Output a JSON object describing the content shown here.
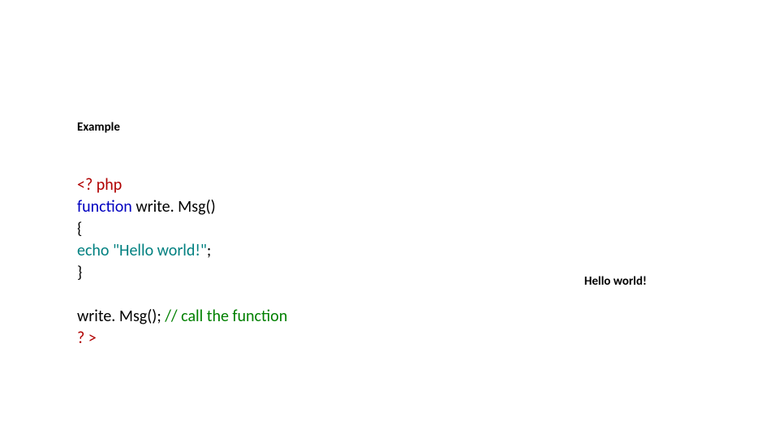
{
  "heading": "Example",
  "code": {
    "open_tag": "<? php",
    "func_kw": "function",
    "sp1": " ",
    "func_name": "write. Msg",
    "func_parens": "()",
    "brace_open": "{",
    "echo_indent": "    echo ",
    "echo_str": "\"Hello world!\"",
    "echo_end": ";",
    "brace_close": "}",
    "call_name": "write. Msg(); ",
    "comment": "// call the function",
    "close_tag": "? >"
  },
  "output": "Hello world!"
}
